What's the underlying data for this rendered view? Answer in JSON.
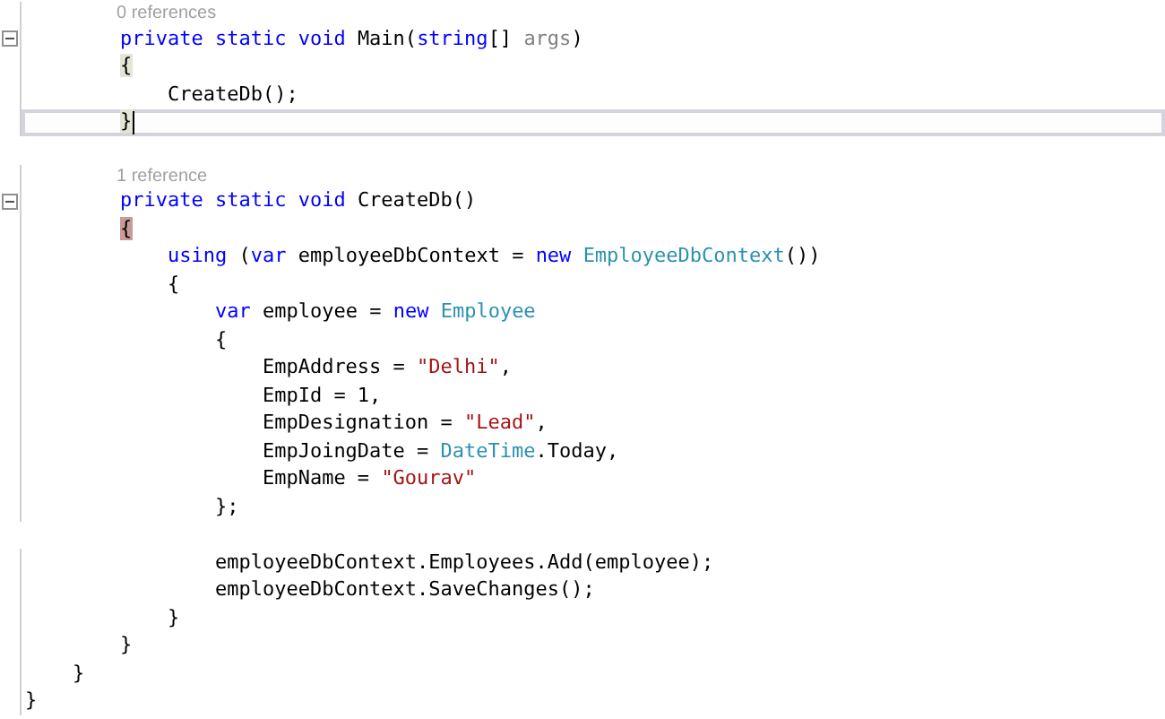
{
  "lines": [
    {
      "kind": "lens",
      "text": "0 references"
    },
    {
      "kind": "code",
      "expanded": true,
      "current": false,
      "tokens": [
        {
          "kind": "kw",
          "t": "        private static void "
        },
        {
          "kind": "plain",
          "t": "Main("
        },
        {
          "kind": "kw",
          "t": "string"
        },
        {
          "kind": "plain",
          "t": "[] "
        },
        {
          "kind": "param",
          "t": "args"
        },
        {
          "kind": "plain",
          "t": ")"
        }
      ]
    },
    {
      "kind": "code",
      "current": false,
      "tokens": [
        {
          "kind": "match",
          "t": "        {"
        }
      ]
    },
    {
      "kind": "code",
      "current": false,
      "tokens": [
        {
          "kind": "plain",
          "t": "            CreateDb();"
        }
      ]
    },
    {
      "kind": "code",
      "current": true,
      "tokens": [
        {
          "kind": "match",
          "t": "        }"
        }
      ]
    },
    {
      "kind": "blank"
    },
    {
      "kind": "lens",
      "text": "1 reference"
    },
    {
      "kind": "code",
      "expanded": true,
      "current": false,
      "tokens": [
        {
          "kind": "kw",
          "t": "        private static void "
        },
        {
          "kind": "plain",
          "t": "CreateDb()"
        }
      ]
    },
    {
      "kind": "code",
      "current": false,
      "tokens": [
        {
          "kind": "marker",
          "t": "        {"
        }
      ]
    },
    {
      "kind": "code",
      "current": false,
      "tokens": [
        {
          "kind": "kw",
          "t": "            using "
        },
        {
          "kind": "plain",
          "t": "("
        },
        {
          "kind": "kw",
          "t": "var "
        },
        {
          "kind": "plain",
          "t": "employeeDbContext = "
        },
        {
          "kind": "kw",
          "t": "new "
        },
        {
          "kind": "type",
          "t": "EmployeeDbContext"
        },
        {
          "kind": "plain",
          "t": "())"
        }
      ]
    },
    {
      "kind": "code",
      "current": false,
      "tokens": [
        {
          "kind": "plain",
          "t": "            {"
        }
      ]
    },
    {
      "kind": "code",
      "current": false,
      "tokens": [
        {
          "kind": "kw",
          "t": "                var "
        },
        {
          "kind": "plain",
          "t": "employee = "
        },
        {
          "kind": "kw",
          "t": "new "
        },
        {
          "kind": "type",
          "t": "Employee"
        }
      ]
    },
    {
      "kind": "code",
      "current": false,
      "tokens": [
        {
          "kind": "plain",
          "t": "                {"
        }
      ]
    },
    {
      "kind": "code",
      "current": false,
      "tokens": [
        {
          "kind": "plain",
          "t": "                    EmpAddress = "
        },
        {
          "kind": "str",
          "t": "\"Delhi\""
        },
        {
          "kind": "plain",
          "t": ","
        }
      ]
    },
    {
      "kind": "code",
      "current": false,
      "tokens": [
        {
          "kind": "plain",
          "t": "                    EmpId = 1,"
        }
      ]
    },
    {
      "kind": "code",
      "current": false,
      "tokens": [
        {
          "kind": "plain",
          "t": "                    EmpDesignation = "
        },
        {
          "kind": "str",
          "t": "\"Lead\""
        },
        {
          "kind": "plain",
          "t": ","
        }
      ]
    },
    {
      "kind": "code",
      "current": false,
      "tokens": [
        {
          "kind": "plain",
          "t": "                    EmpJoingDate = "
        },
        {
          "kind": "type",
          "t": "DateTime"
        },
        {
          "kind": "plain",
          "t": ".Today,"
        }
      ]
    },
    {
      "kind": "code",
      "current": false,
      "tokens": [
        {
          "kind": "plain",
          "t": "                    EmpName = "
        },
        {
          "kind": "str",
          "t": "\"Gourav\""
        }
      ]
    },
    {
      "kind": "code",
      "current": false,
      "tokens": [
        {
          "kind": "plain",
          "t": "                };"
        }
      ]
    },
    {
      "kind": "blank"
    },
    {
      "kind": "code",
      "current": false,
      "tokens": [
        {
          "kind": "plain",
          "t": "                employeeDbContext.Employees.Add(employee);"
        }
      ]
    },
    {
      "kind": "code",
      "current": false,
      "tokens": [
        {
          "kind": "plain",
          "t": "                employeeDbContext.SaveChanges();"
        }
      ]
    },
    {
      "kind": "code",
      "current": false,
      "tokens": [
        {
          "kind": "plain",
          "t": "            }"
        }
      ]
    },
    {
      "kind": "code",
      "current": false,
      "tokens": [
        {
          "kind": "plain",
          "t": "        }"
        }
      ]
    },
    {
      "kind": "code",
      "current": false,
      "tokens": [
        {
          "kind": "plain",
          "t": "    }"
        }
      ]
    },
    {
      "kind": "code",
      "current": false,
      "tokens": [
        {
          "kind": "plain",
          "t": "}"
        }
      ]
    }
  ]
}
